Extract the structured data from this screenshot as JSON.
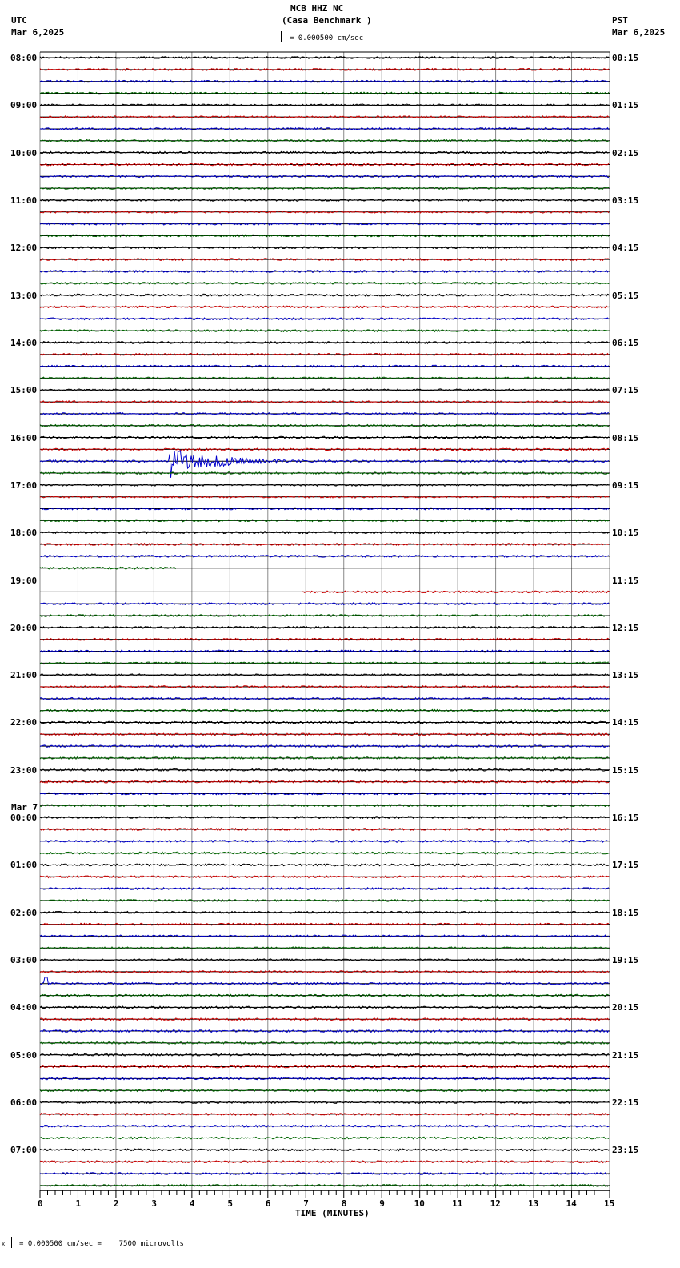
{
  "header": {
    "station": "MCB HHZ NC",
    "site": "(Casa Benchmark )",
    "left_tz": "UTC",
    "left_date": "Mar 6,2025",
    "right_tz": "PST",
    "right_date": "Mar 6,2025",
    "scale_label": "= 0.000500 cm/sec"
  },
  "footer": {
    "scale_text": "= 0.000500 cm/sec =    7500 microvolts",
    "scale_prefix": "x"
  },
  "day_change_label": "Mar 7",
  "chart_data": {
    "type": "line",
    "title": "MCB HHZ NC (Casa Benchmark )",
    "xlabel": "TIME (MINUTES)",
    "xlim": [
      0,
      15
    ],
    "x_ticks": [
      "0",
      "1",
      "2",
      "3",
      "4",
      "5",
      "6",
      "7",
      "8",
      "9",
      "10",
      "11",
      "12",
      "13",
      "14",
      "15"
    ],
    "rows_per_hour": 4,
    "trace_colors": [
      "#000000",
      "#cc0000",
      "#0000cc",
      "#006600"
    ],
    "left_labels": [
      "08:00",
      "09:00",
      "10:00",
      "11:00",
      "12:00",
      "13:00",
      "14:00",
      "15:00",
      "16:00",
      "17:00",
      "18:00",
      "19:00",
      "20:00",
      "21:00",
      "22:00",
      "23:00",
      "00:00",
      "01:00",
      "02:00",
      "03:00",
      "04:00",
      "05:00",
      "06:00",
      "07:00"
    ],
    "right_labels": [
      "00:15",
      "01:15",
      "02:15",
      "03:15",
      "04:15",
      "05:15",
      "06:15",
      "07:15",
      "08:15",
      "09:15",
      "10:15",
      "11:15",
      "12:15",
      "13:15",
      "14:15",
      "15:15",
      "16:15",
      "17:15",
      "18:15",
      "19:15",
      "20:15",
      "21:15",
      "22:15",
      "23:15"
    ],
    "events": [
      {
        "row_utc": "16:30",
        "start_minute": 3.4,
        "duration_minutes": 4.5,
        "peak_relative_amplitude": 1.0,
        "label": "earthquake"
      },
      {
        "row_utc": "03:30",
        "start_minute": 0.1,
        "duration_minutes": 0.1,
        "peak_relative_amplitude": 0.4,
        "label": "spike"
      }
    ],
    "gaps": [
      {
        "from_utc": "18:45",
        "from_minute": 3.6,
        "to_utc": "19:15",
        "to_minute": 6.9
      }
    ]
  }
}
